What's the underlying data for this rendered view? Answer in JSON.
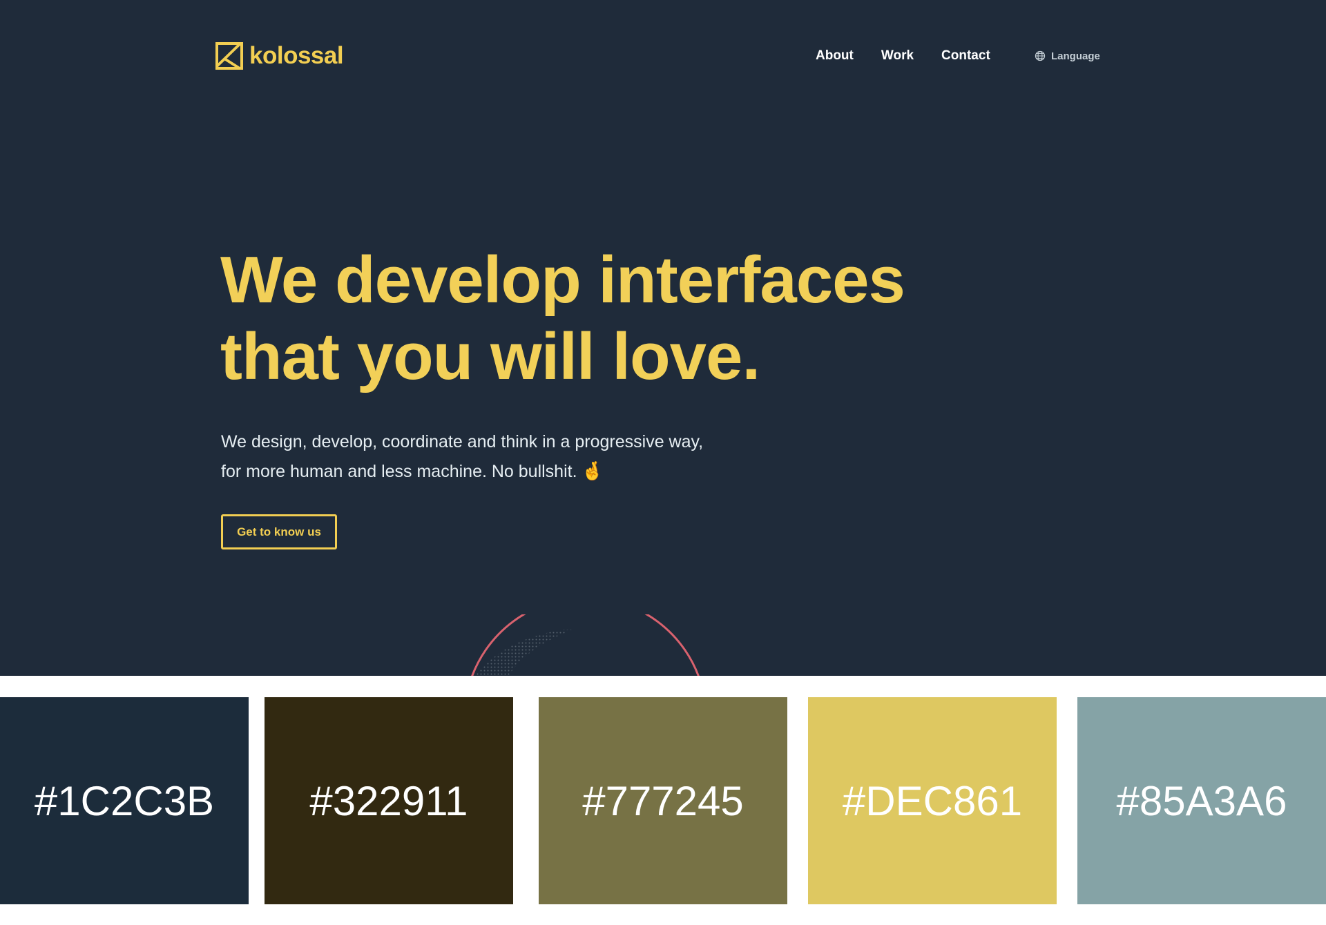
{
  "nav": {
    "logo_text": "kolossal",
    "links": [
      "About",
      "Work",
      "Contact"
    ],
    "language_label": "Language"
  },
  "hero": {
    "headline_line_1": "We develop interfaces",
    "headline_line_2": "that you will love.",
    "subtext_line_1": "We design, develop, coordinate and think in a progressive way,",
    "subtext_line_2": "for more human and less machine. No bullshit.",
    "emoji": "🤞",
    "cta_label": "Get to know us"
  },
  "palette": [
    {
      "label": "#1C2C3B",
      "color": "#1c2c3b"
    },
    {
      "label": "#322911",
      "color": "#322911"
    },
    {
      "label": "#777245",
      "color": "#777245"
    },
    {
      "label": "#DEC861",
      "color": "#dec861"
    },
    {
      "label": "#85A3A6",
      "color": "#85a3a6"
    }
  ],
  "colors": {
    "hero_background": "#1f2b3a",
    "accent": "#f2ce52",
    "arc": "#d9626e"
  }
}
